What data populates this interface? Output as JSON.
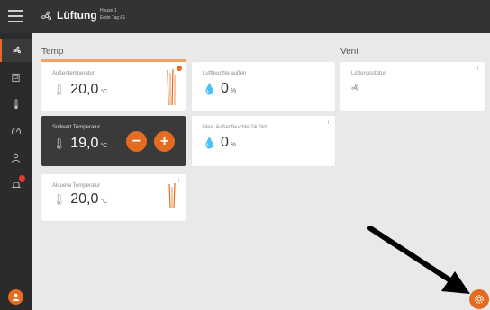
{
  "header": {
    "title": "Lüftung",
    "subtitle_line1": "House 1",
    "subtitle_line2": "Erste Tag A1"
  },
  "sections": {
    "temp_label": "Temp",
    "vent_label": "Vent"
  },
  "cards": {
    "outside_temp": {
      "title": "Außentemperatur",
      "value": "20,0",
      "unit": "°C"
    },
    "setpoint_temp": {
      "title": "Sollwert Temperatur",
      "value": "19,0",
      "unit": "°C",
      "minus_label": "−",
      "plus_label": "+"
    },
    "current_temp": {
      "title": "Aktuelle Temperatur",
      "value": "20,0",
      "unit": "°C"
    },
    "humidity_outside": {
      "title": "Luftfeuchte außen",
      "value": "0",
      "unit": "%"
    },
    "max_humidity": {
      "title": "Max. Außenfeuchte 24 Std",
      "value": "0",
      "unit": "%"
    },
    "vent_status": {
      "title": "Lüftungsstatus"
    }
  },
  "icons": {
    "menu": "hamburger-icon",
    "fan": "fan-icon",
    "thermometer": "thermometer-icon",
    "humidity": "humidity-icon",
    "settings": "gear-icon",
    "info": "info-icon"
  },
  "colors": {
    "accent": "#e46b1f",
    "sidebar": "#2b2b2b",
    "header": "#333333",
    "card_dark": "#3a3a3a",
    "background": "#e9e9e9"
  }
}
